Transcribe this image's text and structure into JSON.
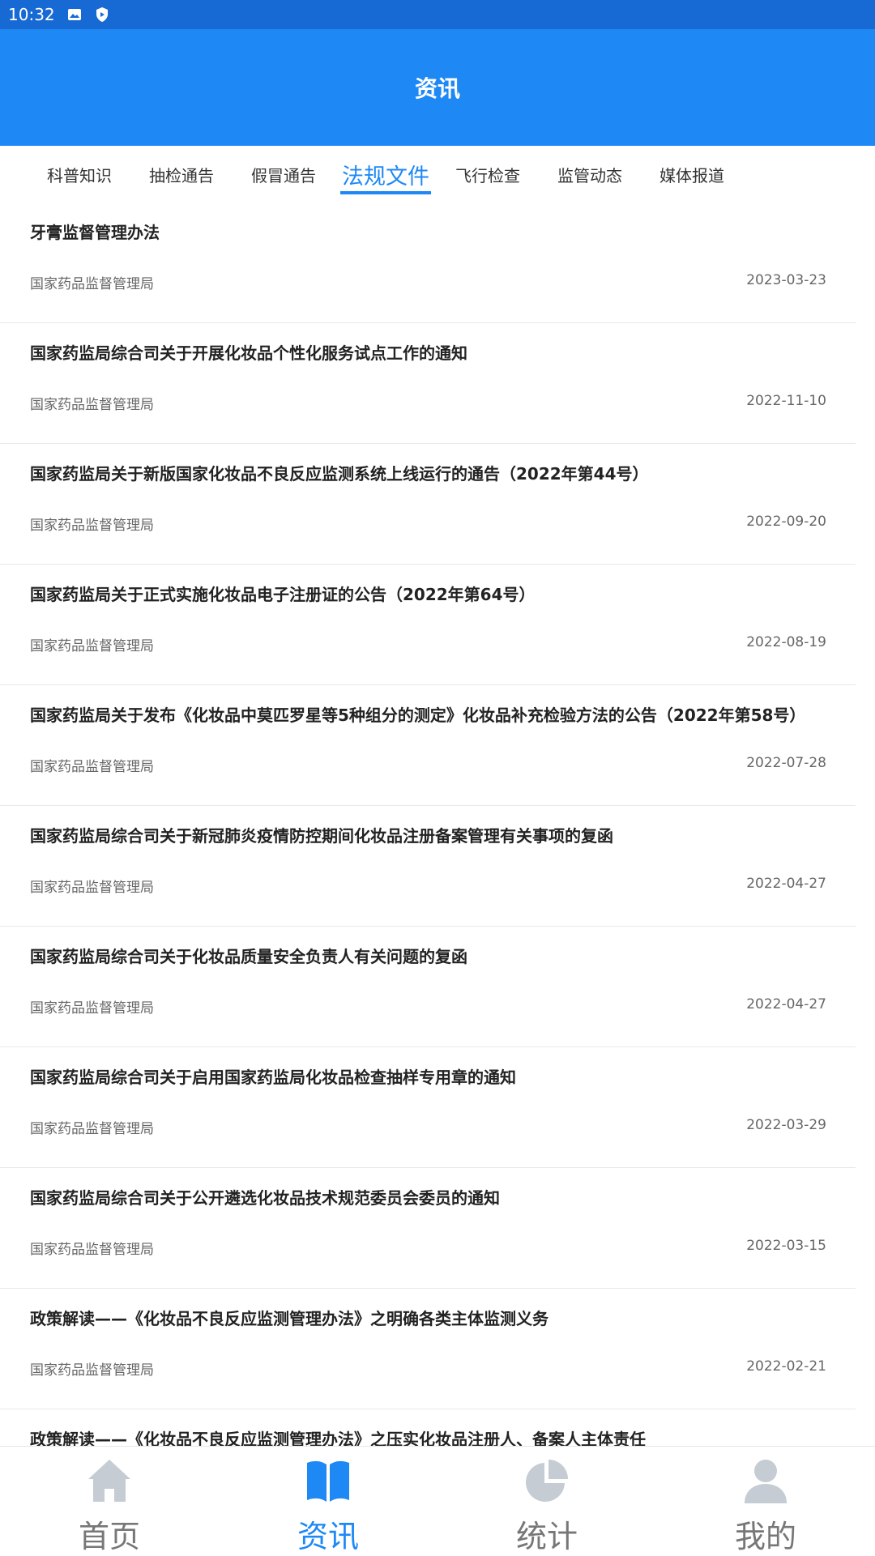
{
  "status_bar": {
    "time": "10:32",
    "icons": [
      "image-icon",
      "shield-play-icon"
    ]
  },
  "header": {
    "title": "资讯"
  },
  "tabs": [
    {
      "label": "科普知识",
      "active": false
    },
    {
      "label": "抽检通告",
      "active": false
    },
    {
      "label": "假冒通告",
      "active": false
    },
    {
      "label": "法规文件",
      "active": true
    },
    {
      "label": "飞行检查",
      "active": false
    },
    {
      "label": "监管动态",
      "active": false
    },
    {
      "label": "媒体报道",
      "active": false
    }
  ],
  "articles": [
    {
      "title": "牙膏监督管理办法",
      "source": "国家药品监督管理局",
      "date": "2023-03-23"
    },
    {
      "title": "国家药监局综合司关于开展化妆品个性化服务试点工作的通知",
      "source": "国家药品监督管理局",
      "date": "2022-11-10"
    },
    {
      "title": "国家药监局关于新版国家化妆品不良反应监测系统上线运行的通告（2022年第44号）",
      "source": "国家药品监督管理局",
      "date": "2022-09-20"
    },
    {
      "title": "国家药监局关于正式实施化妆品电子注册证的公告（2022年第64号）",
      "source": "国家药品监督管理局",
      "date": "2022-08-19"
    },
    {
      "title": "国家药监局关于发布《化妆品中莫匹罗星等5种组分的测定》化妆品补充检验方法的公告（2022年第58号）",
      "source": "国家药品监督管理局",
      "date": "2022-07-28"
    },
    {
      "title": "国家药监局综合司关于新冠肺炎疫情防控期间化妆品注册备案管理有关事项的复函",
      "source": "国家药品监督管理局",
      "date": "2022-04-27"
    },
    {
      "title": "国家药监局综合司关于化妆品质量安全负责人有关问题的复函",
      "source": "国家药品监督管理局",
      "date": "2022-04-27"
    },
    {
      "title": "国家药监局综合司关于启用国家药监局化妆品检查抽样专用章的通知",
      "source": "国家药品监督管理局",
      "date": "2022-03-29"
    },
    {
      "title": "国家药监局综合司关于公开遴选化妆品技术规范委员会委员的通知",
      "source": "国家药品监督管理局",
      "date": "2022-03-15"
    },
    {
      "title": "政策解读——《化妆品不良反应监测管理办法》之明确各类主体监测义务",
      "source": "国家药品监督管理局",
      "date": "2022-02-21"
    },
    {
      "title": "政策解读——《化妆品不良反应监测管理办法》之压实化妆品注册人、备案人主体责任",
      "source": "",
      "date": ""
    }
  ],
  "bottom_nav": [
    {
      "label": "首页",
      "icon": "home-icon",
      "active": false
    },
    {
      "label": "资讯",
      "icon": "book-icon",
      "active": true
    },
    {
      "label": "统计",
      "icon": "pie-chart-icon",
      "active": false
    },
    {
      "label": "我的",
      "icon": "user-icon",
      "active": false
    }
  ],
  "colors": {
    "accent": "#1e88f5",
    "status_bar": "#1769d4",
    "inactive_icon": "#c5ccd3"
  }
}
